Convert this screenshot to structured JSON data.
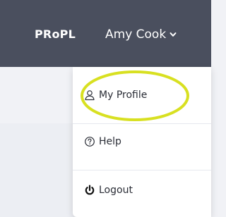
{
  "header": {
    "brand": "PRoPL",
    "user_name": "Amy Cook"
  },
  "dropdown": {
    "items": [
      {
        "label": "My Profile",
        "icon": "user-icon"
      },
      {
        "label": "Help",
        "icon": "help-circle-icon"
      },
      {
        "label": "Logout",
        "icon": "power-icon"
      }
    ]
  },
  "colors": {
    "topbar": "#4a4f5e",
    "highlight": "#d8e021",
    "page_bg": "#f1f2f6"
  }
}
